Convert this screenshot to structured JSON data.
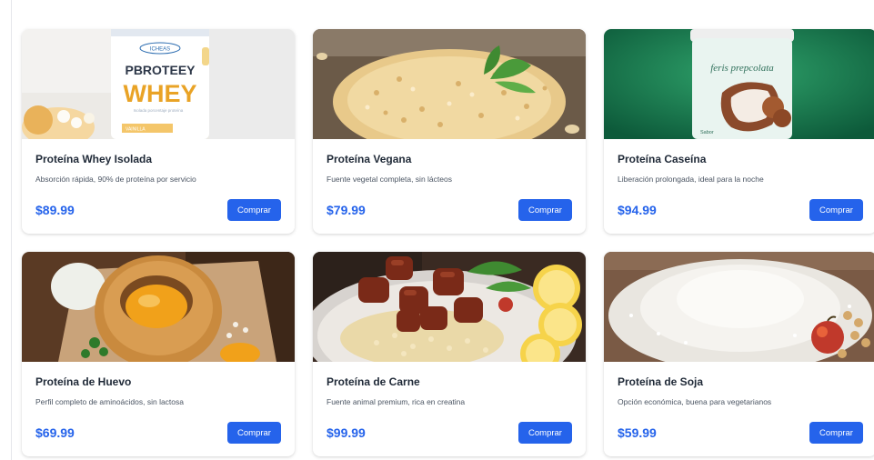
{
  "products": [
    {
      "name": "Proteína Whey Isolada",
      "description": "Absorción rápida, 90% de proteína por servicio",
      "price": "$89.99",
      "button": "Comprar",
      "image": {
        "kind": "whey-jar-photo",
        "jar_brand": "ICHEAS",
        "jar_title": "PBROTEEY",
        "jar_big": "WHEY",
        "jar_small": "Isolada porcentaje proteína",
        "jar_band": "VAINILLA"
      }
    },
    {
      "name": "Proteína Vegana",
      "description": "Fuente vegetal completa, sin lácteos",
      "price": "$79.99",
      "button": "Comprar",
      "image": {
        "kind": "vegan-grain-photo"
      }
    },
    {
      "name": "Proteína Caseína",
      "description": "Liberación prolongada, ideal para la noche",
      "price": "$94.99",
      "button": "Comprar",
      "image": {
        "kind": "casein-jar-photo",
        "jar_title": "feris prepcolata",
        "jar_small": "Sabor"
      }
    },
    {
      "name": "Proteína de Huevo",
      "description": "Perfil completo de aminoácidos, sin lactosa",
      "price": "$69.99",
      "button": "Comprar",
      "image": {
        "kind": "egg-bread-photo"
      }
    },
    {
      "name": "Proteína de Carne",
      "description": "Fuente animal premium, rica en creatina",
      "price": "$99.99",
      "button": "Comprar",
      "image": {
        "kind": "meat-plate-photo"
      }
    },
    {
      "name": "Proteína de Soja",
      "description": "Opción económica, buena para vegetarianos",
      "price": "$59.99",
      "button": "Comprar",
      "image": {
        "kind": "soy-powder-photo"
      }
    }
  ],
  "colors": {
    "accent": "#2563eb",
    "title": "#1f2937",
    "muted": "#4b5563"
  }
}
